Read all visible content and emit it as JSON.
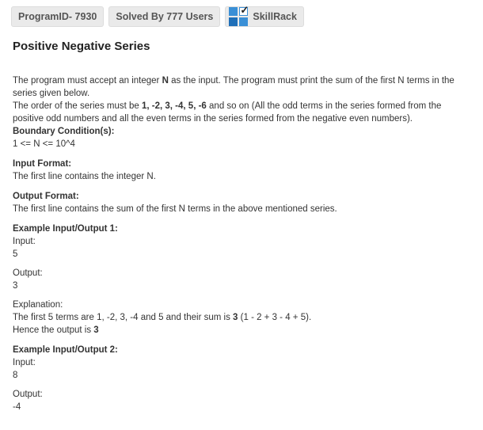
{
  "header": {
    "program_id": "ProgramID- 7930",
    "solved_by": "Solved By 777 Users",
    "brand_name": "SkillRack",
    "brand_icon": "skillrack-logo-icon"
  },
  "problem": {
    "title": "Positive Negative Series",
    "description": {
      "line1_pre": "The program must accept an integer ",
      "line1_bold": "N",
      "line1_post": " as the input. The program must print the sum of the first N terms in the series given below.",
      "line2_pre": "The order of the series must be ",
      "line2_bold": "1, -2, 3, -4, 5, -6",
      "line2_post": " and so on (All the odd terms in the series formed from the positive odd numbers and all the even terms in the series formed from the negative even numbers)."
    },
    "boundary": {
      "heading": "Boundary Condition(s):",
      "text": "1 <= N <= 10^4"
    },
    "input_format": {
      "heading": "Input Format:",
      "text": "The first line contains the integer N."
    },
    "output_format": {
      "heading": "Output Format:",
      "text": "The first line contains the sum of the first N terms in the above mentioned series."
    },
    "example1": {
      "heading": "Example Input/Output 1:",
      "input_label": "Input:",
      "input_value": "5",
      "output_label": "Output:",
      "output_value": "3",
      "explanation_label": "Explanation:",
      "explanation_pre": "The first 5 terms are 1, -2, 3, -4 and 5 and their sum is ",
      "explanation_bold": "3",
      "explanation_post": " (1 - 2 + 3 - 4 + 5).",
      "hence_pre": "Hence the output is ",
      "hence_bold": "3"
    },
    "example2": {
      "heading": "Example Input/Output 2:",
      "input_label": "Input:",
      "input_value": "8",
      "output_label": "Output:",
      "output_value": "-4"
    }
  }
}
